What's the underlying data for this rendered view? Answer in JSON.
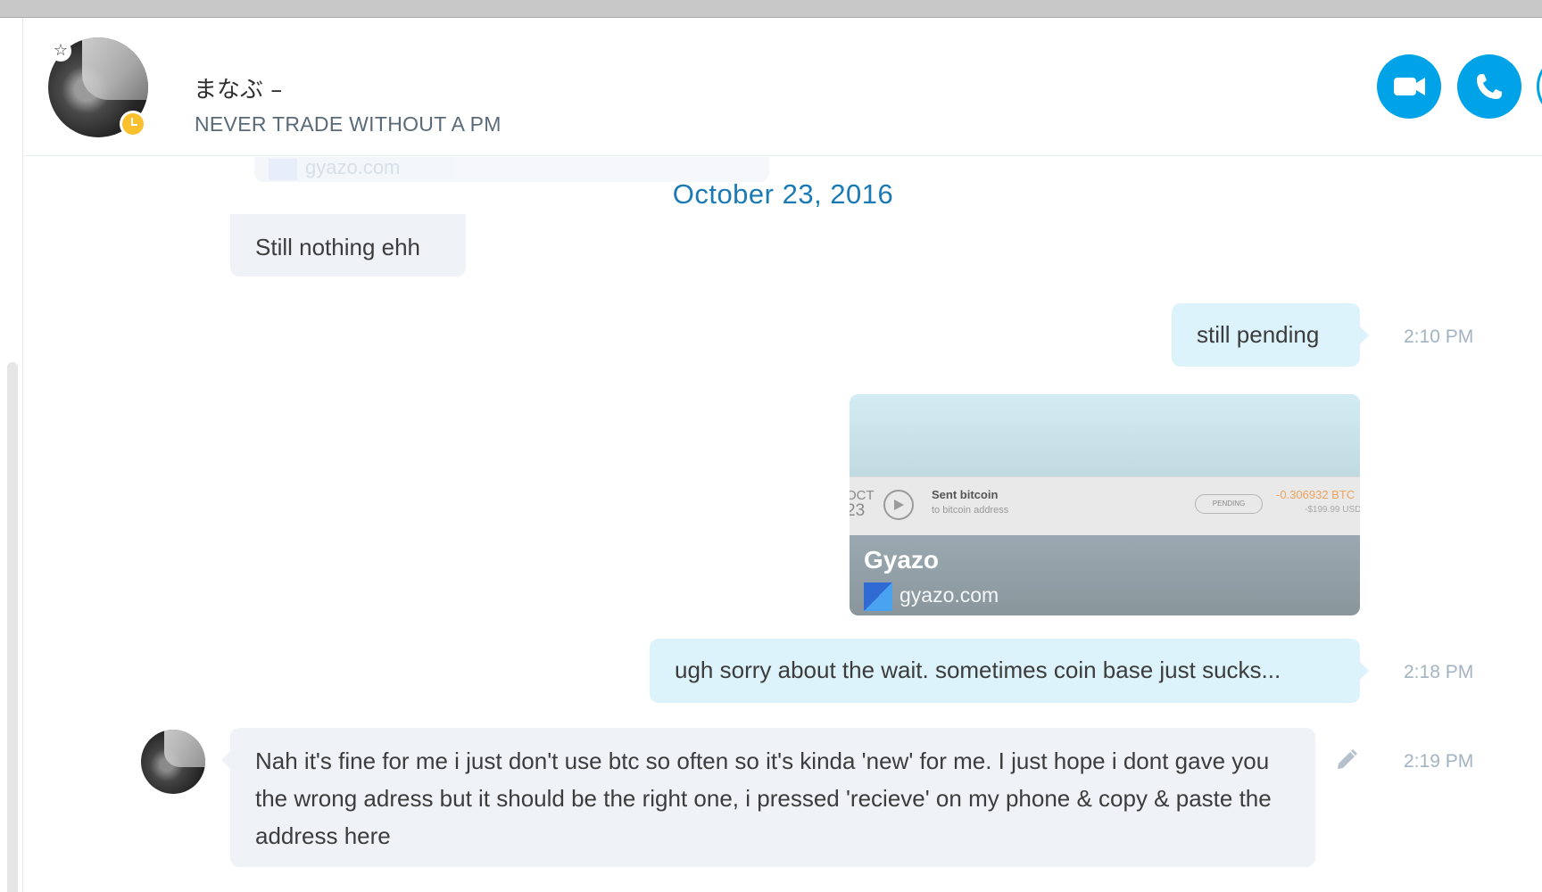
{
  "header": {
    "contact_name": "まなぶ –",
    "mood_message": "NEVER TRADE WITHOUT A PM",
    "favorite_icon": "star-icon",
    "presence": "away",
    "presence_color": "#fbc02d",
    "accent_color": "#00a2e8"
  },
  "conversation": {
    "previous_link_domain": "gyazo.com",
    "date_divider": "October 23, 2016",
    "messages": [
      {
        "direction": "incoming",
        "text": "Still nothing ehh",
        "time": ""
      },
      {
        "direction": "outgoing",
        "text": "still pending",
        "time": "2:10 PM"
      },
      {
        "direction": "outgoing",
        "type": "link_preview",
        "title": "Gyazo",
        "domain": "gyazo.com",
        "screenshot": {
          "date_month": "OCT",
          "date_day": "23",
          "title": "Sent bitcoin",
          "subtitle": "to bitcoin address",
          "status": "PENDING",
          "amount": "-0.306932 BTC",
          "amount_usd": "-$199.99 USD"
        }
      },
      {
        "direction": "outgoing",
        "text": "ugh sorry about the wait. sometimes coin base just sucks...",
        "time": "2:18 PM"
      },
      {
        "direction": "incoming",
        "text": "Nah it's fine for me i just don't use btc so often so it's kinda 'new' for me. I just hope i dont gave you the wrong adress but it should be the right one, i pressed 'recieve' on my phone & copy & paste the address here",
        "time": "2:19 PM"
      }
    ]
  }
}
